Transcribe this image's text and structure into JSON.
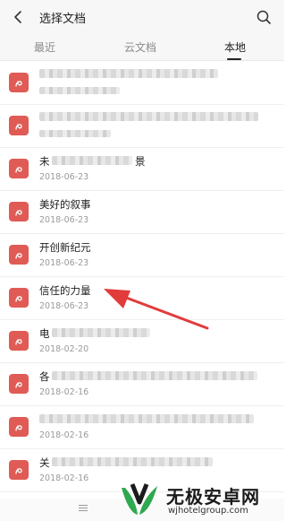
{
  "header": {
    "title": "选择文档"
  },
  "tabs": [
    {
      "label": "最近",
      "active": false
    },
    {
      "label": "云文档",
      "active": false
    },
    {
      "label": "本地",
      "active": true
    }
  ],
  "files": [
    {
      "name": "",
      "date": "",
      "blurred": true
    },
    {
      "name": "",
      "date": "",
      "blurred": true
    },
    {
      "name": "未",
      "name_tail": "景",
      "date": "2018-06-23",
      "blurred": true
    },
    {
      "name": "美好的叙事",
      "date": "2018-06-23",
      "blurred": false
    },
    {
      "name": "开创新纪元",
      "date": "2018-06-23",
      "blurred": false
    },
    {
      "name": "信任的力量",
      "date": "2018-06-23",
      "blurred": false
    },
    {
      "name": "电",
      "date": "2018-02-20",
      "blurred": true
    },
    {
      "name": "各",
      "date": "2018-02-16",
      "blurred": true
    },
    {
      "name": "",
      "date": "2018-02-16",
      "blurred": true
    },
    {
      "name": "关",
      "date": "2018-02-16",
      "blurred": true
    }
  ],
  "watermark": {
    "cn": "无极安卓网",
    "en": "wjhotelgroup.com"
  },
  "colors": {
    "file_icon": "#e05b55",
    "arrow": "#e23b3b",
    "logo_green": "#2fa84f"
  },
  "icons": {
    "back": "chevron-left-icon",
    "search": "search-icon",
    "file": "pdf-file-icon"
  }
}
